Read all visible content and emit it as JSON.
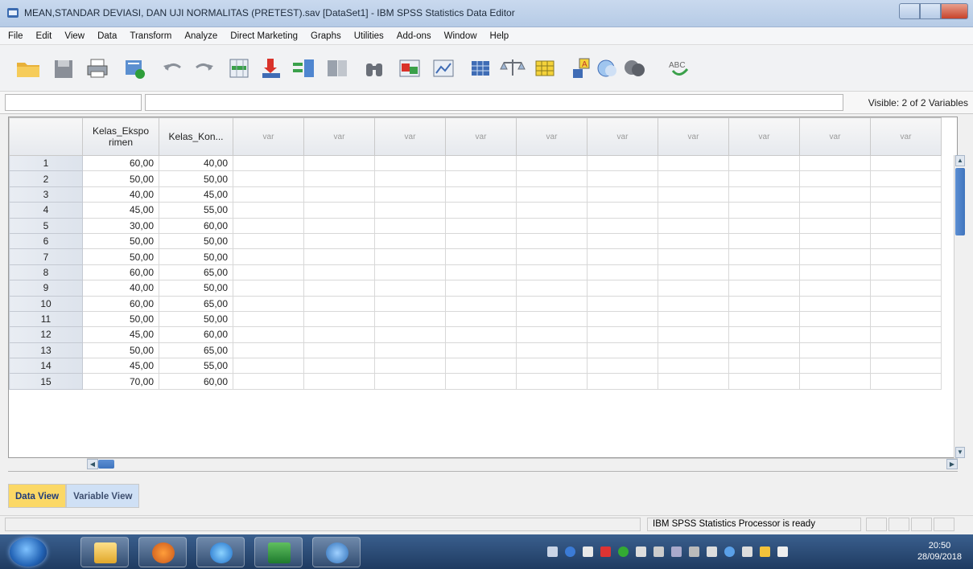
{
  "window": {
    "title": "MEAN,STANDAR DEVIASI, DAN UJI NORMALITAS (PRETEST).sav [DataSet1] - IBM SPSS Statistics Data Editor"
  },
  "menu": [
    "File",
    "Edit",
    "View",
    "Data",
    "Transform",
    "Analyze",
    "Direct Marketing",
    "Graphs",
    "Utilities",
    "Add-ons",
    "Window",
    "Help"
  ],
  "toolbar": {
    "icons": [
      "open-data-icon",
      "save-icon",
      "print-icon",
      "recall-dialog-icon",
      "undo-icon",
      "redo-icon",
      "goto-case-icon",
      "goto-variable-icon",
      "variables-icon",
      "run-descriptives-icon",
      "find-icon",
      "insert-cases-icon",
      "insert-variable-icon",
      "split-file-icon",
      "weight-cases-icon",
      "select-cases-icon",
      "value-labels-icon",
      "use-sets-icon",
      "show-all-variables-icon",
      "spell-check-icon"
    ]
  },
  "editor": {
    "cell_reference": "",
    "cell_value": "",
    "visible_label": "Visible: 2 of 2 Variables"
  },
  "grid": {
    "columns": [
      "Kelas_Ekspo rimen",
      "Kelas_Kon...",
      "var",
      "var",
      "var",
      "var",
      "var",
      "var",
      "var",
      "var",
      "var",
      "var"
    ],
    "rows": [
      {
        "n": "1",
        "a": "60,00",
        "b": "40,00"
      },
      {
        "n": "2",
        "a": "50,00",
        "b": "50,00"
      },
      {
        "n": "3",
        "a": "40,00",
        "b": "45,00"
      },
      {
        "n": "4",
        "a": "45,00",
        "b": "55,00"
      },
      {
        "n": "5",
        "a": "30,00",
        "b": "60,00"
      },
      {
        "n": "6",
        "a": "50,00",
        "b": "50,00"
      },
      {
        "n": "7",
        "a": "50,00",
        "b": "50,00"
      },
      {
        "n": "8",
        "a": "60,00",
        "b": "65,00"
      },
      {
        "n": "9",
        "a": "40,00",
        "b": "50,00"
      },
      {
        "n": "10",
        "a": "60,00",
        "b": "65,00"
      },
      {
        "n": "11",
        "a": "50,00",
        "b": "50,00"
      },
      {
        "n": "12",
        "a": "45,00",
        "b": "60,00"
      },
      {
        "n": "13",
        "a": "50,00",
        "b": "65,00"
      },
      {
        "n": "14",
        "a": "45,00",
        "b": "55,00"
      },
      {
        "n": "15",
        "a": "70,00",
        "b": "60,00"
      }
    ]
  },
  "tabs": {
    "data_view": "Data View",
    "variable_view": "Variable View"
  },
  "status": {
    "processor": "IBM SPSS Statistics Processor is ready"
  },
  "taskbar": {
    "time": "20:50",
    "date": "28/09/2018"
  }
}
